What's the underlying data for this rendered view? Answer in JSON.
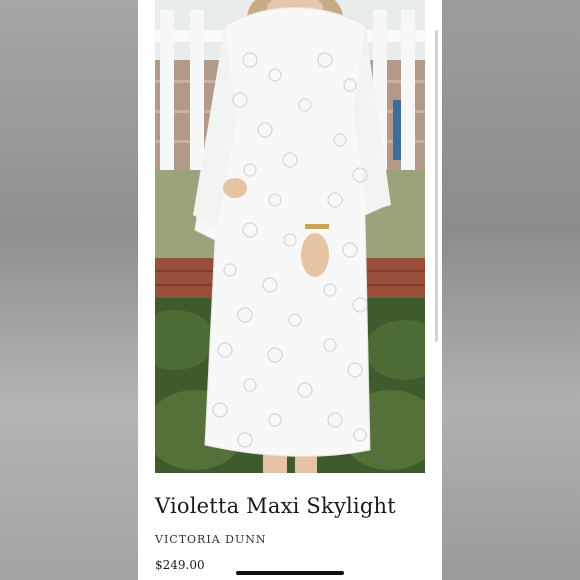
{
  "product": {
    "title": "Violetta Maxi Skylight",
    "brand": "VICTORIA DUNN",
    "price": "$249.00",
    "image_icon": "product-photo"
  },
  "colors": {
    "card_background": "#ffffff",
    "dress": "#f7f8f7",
    "foliage": "#3f5a2c"
  }
}
